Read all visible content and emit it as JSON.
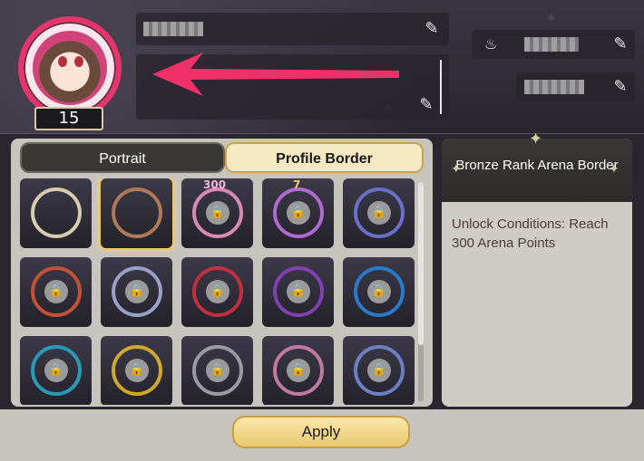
{
  "profile": {
    "level": "15"
  },
  "tabs": {
    "portrait": "Portrait",
    "profile_border": "Profile Border"
  },
  "selected_border": {
    "title": "Bronze Rank Arena Border",
    "unlock_conditions": "Unlock Conditions: Reach 300 Arena Points"
  },
  "grid_labels": {
    "top_300": "300",
    "top_7": "7"
  },
  "actions": {
    "apply": "Apply"
  },
  "colors": {
    "accent_pink": "#e8346d",
    "gold": "#f0c860"
  },
  "icons": {
    "edit": "pencil-icon",
    "birthday": "cake-icon",
    "lock": "lock-icon",
    "sparkle": "diamond-icon"
  }
}
